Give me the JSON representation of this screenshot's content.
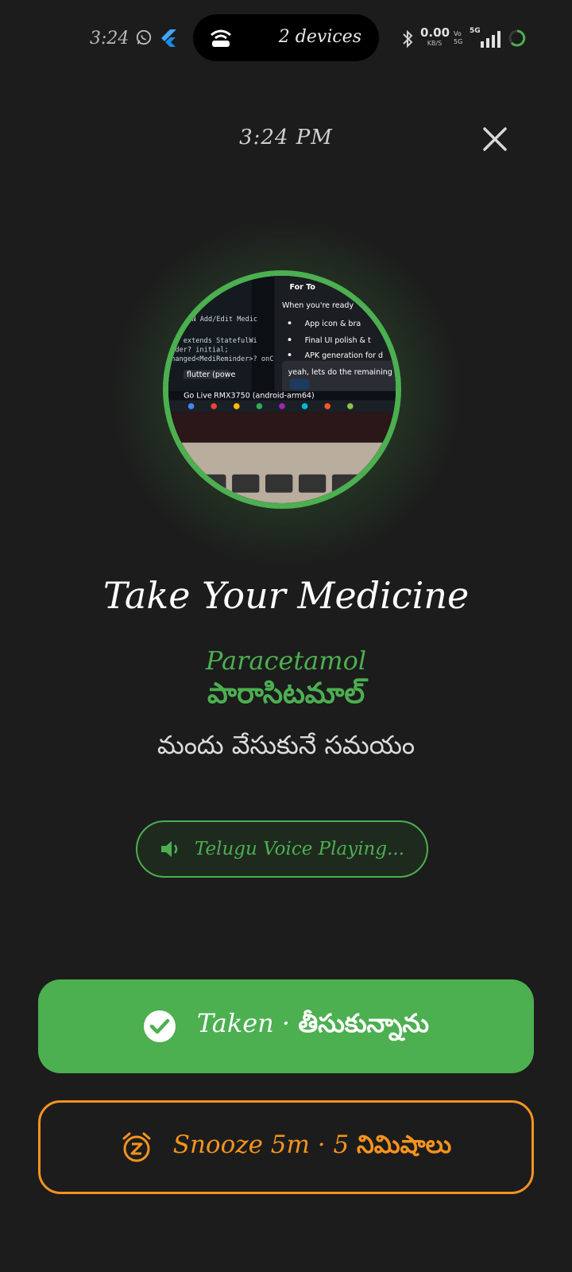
{
  "status_bar": {
    "time": "3:24",
    "pill_text": "2 devices",
    "net_speed": "0.00",
    "net_unit": "KB/S",
    "network_type": "5G",
    "icons": [
      "whatsapp-icon",
      "flutter-icon",
      "hotspot-icon",
      "bluetooth-icon",
      "signal-icon",
      "battery-icon"
    ]
  },
  "header": {
    "time": "3:24 PM",
    "close_icon": "close-icon"
  },
  "photo": {
    "code_lines": [
      "ERN Add/Edit Medic",
      "age extends StatefulWi",
      "inder? initial;",
      "Changed<MediReminder>? onC"
    ],
    "panel_title": "For To",
    "panel_lines": [
      "When you're ready",
      "App icon & bra",
      "Final UI polish & t",
      "APK generation for d"
    ],
    "chat_text": "yeah, lets do the remaining",
    "taskbar_label": "Go Live",
    "terminal_tab": "flutter (powe",
    "device_label": "RMX3750 (android-arm64)"
  },
  "title": "Take Your Medicine",
  "medicine": {
    "name_en": "Paracetamol",
    "name_te": "పారాసిటమాల్"
  },
  "subtitle": "మందు వేసుకునే సమయం",
  "voice_status": "Telugu Voice Playing...",
  "buttons": {
    "taken_en": "Taken · ",
    "taken_te": "తీసుకున్నాను",
    "snooze_en": "Snooze 5m · 5 ",
    "snooze_te": "నిమిషాలు"
  },
  "colors": {
    "background": "#1c1c1c",
    "accent_green": "#4caf50",
    "accent_orange": "#f7931e"
  }
}
